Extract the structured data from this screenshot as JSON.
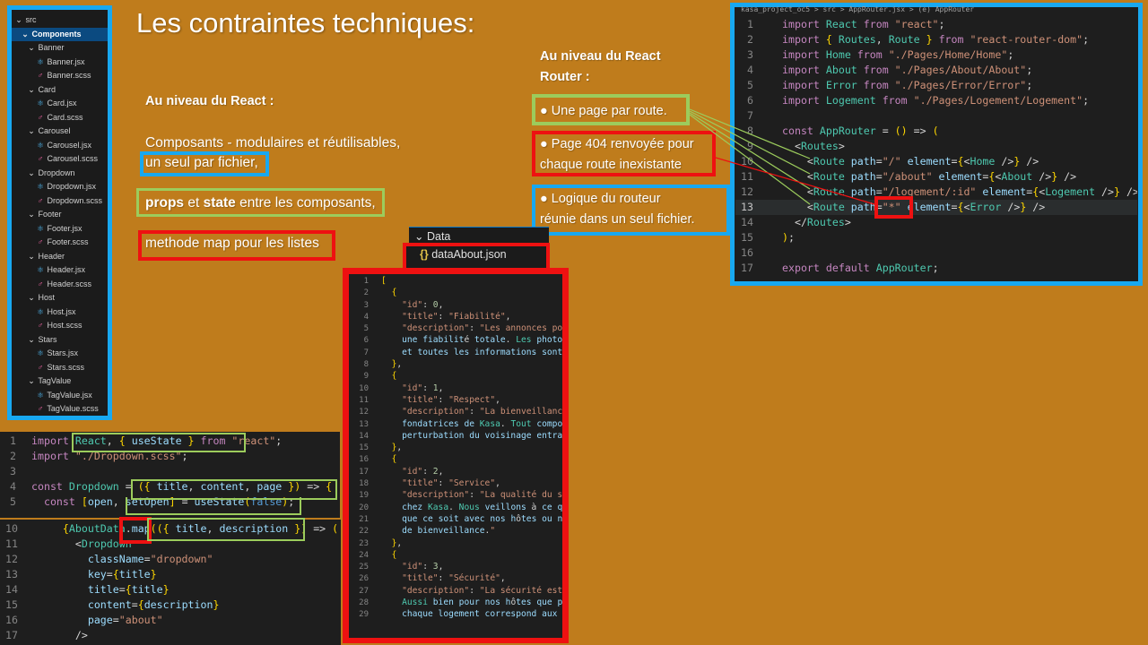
{
  "slide": {
    "title": "Les contraintes techniques:",
    "react_heading": "Au niveau du React :",
    "react_line1": "Composants - modulaires et réutilisables,",
    "react_line2": "un seul par fichier,",
    "props_bold": "props",
    "props_and": " et ",
    "state_bold": "state",
    "props_rest": " entre les composants,",
    "map_text": " methode map pour les listes",
    "router_heading_1": "Au niveau du React",
    "router_heading_2": "Router :",
    "bullet1": "● Une page par route.",
    "bullet2_1": "● Page 404 renvoyée pour",
    "bullet2_2": "chaque route inexistante",
    "bullet3_1": "● Logique du routeur",
    "bullet3_2": "réunie dans un seul fichier."
  },
  "file_tree": {
    "root": "src",
    "selected": "Components",
    "groups": [
      {
        "folder": "Banner",
        "files": [
          "Banner.jsx",
          "Banner.scss"
        ]
      },
      {
        "folder": "Card",
        "files": [
          "Card.jsx",
          "Card.scss"
        ]
      },
      {
        "folder": "Carousel",
        "files": [
          "Carousel.jsx",
          "Carousel.scss"
        ]
      },
      {
        "folder": "Dropdown",
        "files": [
          "Dropdown.jsx",
          "Dropdown.scss"
        ]
      },
      {
        "folder": "Footer",
        "files": [
          "Footer.jsx",
          "Footer.scss"
        ]
      },
      {
        "folder": "Header",
        "files": [
          "Header.jsx",
          "Header.scss"
        ]
      },
      {
        "folder": "Host",
        "files": [
          "Host.jsx",
          "Host.scss"
        ]
      },
      {
        "folder": "Stars",
        "files": [
          "Stars.jsx",
          "Stars.scss"
        ]
      },
      {
        "folder": "TagValue",
        "files": [
          "TagValue.jsx",
          "TagValue.scss"
        ]
      }
    ]
  },
  "data_explorer": {
    "folder": "Data",
    "file": "dataAbout.json"
  },
  "router_editor": {
    "breadcrumb": "kasa_project_oc5 > src > AppRouter.jsx > (e) AppRouter",
    "active_line": 13,
    "lines": [
      {
        "n": 1,
        "t": "import React from \"react\";"
      },
      {
        "n": 2,
        "t": "import { Routes, Route } from \"react-router-dom\";"
      },
      {
        "n": 3,
        "t": "import Home from \"./Pages/Home/Home\";"
      },
      {
        "n": 4,
        "t": "import About from \"./Pages/About/About\";"
      },
      {
        "n": 5,
        "t": "import Error from \"./Pages/Error/Error\";"
      },
      {
        "n": 6,
        "t": "import Logement from \"./Pages/Logement/Logement\";"
      },
      {
        "n": 7,
        "t": ""
      },
      {
        "n": 8,
        "t": "const AppRouter = () => ("
      },
      {
        "n": 9,
        "t": "  <Routes>"
      },
      {
        "n": 10,
        "t": "    <Route path=\"/\" element={<Home />} />"
      },
      {
        "n": 11,
        "t": "    <Route path=\"/about\" element={<About />} />"
      },
      {
        "n": 12,
        "t": "    <Route path=\"/logement/:id\" element={<Logement />} />"
      },
      {
        "n": 13,
        "t": "    <Route path=\"*\" element={<Error />} />"
      },
      {
        "n": 14,
        "t": "  </Routes>"
      },
      {
        "n": 15,
        "t": ");"
      },
      {
        "n": 16,
        "t": ""
      },
      {
        "n": 17,
        "t": "export default AppRouter;"
      }
    ]
  },
  "json_editor": {
    "lines": [
      {
        "n": 1,
        "t": "["
      },
      {
        "n": 2,
        "t": "  {"
      },
      {
        "n": 3,
        "t": "    \"id\": 0,"
      },
      {
        "n": 4,
        "t": "    \"title\": \"Fiabilité\","
      },
      {
        "n": 5,
        "t": "    \"description\": \"Les annonces po"
      },
      {
        "n": 6,
        "t": "    une fiabilité totale. Les photo"
      },
      {
        "n": 7,
        "t": "    et toutes les informations sont"
      },
      {
        "n": 8,
        "t": "  },"
      },
      {
        "n": 9,
        "t": "  {"
      },
      {
        "n": 10,
        "t": "    \"id\": 1,"
      },
      {
        "n": 11,
        "t": "    \"title\": \"Respect\","
      },
      {
        "n": 12,
        "t": "    \"description\": \"La bienveillanc"
      },
      {
        "n": 13,
        "t": "    fondatrices de Kasa. Tout compo"
      },
      {
        "n": 14,
        "t": "    perturbation du voisinage entra"
      },
      {
        "n": 15,
        "t": "  },"
      },
      {
        "n": 16,
        "t": "  {"
      },
      {
        "n": 17,
        "t": "    \"id\": 2,"
      },
      {
        "n": 18,
        "t": "    \"title\": \"Service\","
      },
      {
        "n": 19,
        "t": "    \"description\": \"La qualité du s"
      },
      {
        "n": 20,
        "t": "    chez Kasa. Nous veillons à ce q"
      },
      {
        "n": 21,
        "t": "    que ce soit avec nos hôtes ou n"
      },
      {
        "n": 22,
        "t": "    de bienveillance.\""
      },
      {
        "n": 23,
        "t": "  },"
      },
      {
        "n": 24,
        "t": "  {"
      },
      {
        "n": 25,
        "t": "    \"id\": 3,"
      },
      {
        "n": 26,
        "t": "    \"title\": \"Sécurité\","
      },
      {
        "n": 27,
        "t": "    \"description\": \"La sécurité est"
      },
      {
        "n": 28,
        "t": "    Aussi bien pour nos hôtes que p"
      },
      {
        "n": 29,
        "t": "    chaque logement correspond aux"
      }
    ]
  },
  "dropdown_editor": {
    "lines": [
      {
        "n": 1,
        "t": "import React, { useState } from \"react\";"
      },
      {
        "n": 2,
        "t": "import \"./Dropdown.scss\";"
      },
      {
        "n": 3,
        "t": ""
      },
      {
        "n": 4,
        "t": "const Dropdown = ({ title, content, page }) => {"
      },
      {
        "n": 5,
        "t": "  const [open, setOpen] = useState(false);"
      }
    ]
  },
  "map_editor": {
    "lines": [
      {
        "n": 10,
        "t": "    {AboutData.map(({ title, description }) => ("
      },
      {
        "n": 11,
        "t": "      <Dropdown"
      },
      {
        "n": 12,
        "t": "        className=\"dropdown\""
      },
      {
        "n": 13,
        "t": "        key={title}"
      },
      {
        "n": 14,
        "t": "        title={title}"
      },
      {
        "n": 15,
        "t": "        content={description}"
      },
      {
        "n": 16,
        "t": "        page=\"about\""
      },
      {
        "n": 17,
        "t": "      />"
      }
    ]
  },
  "colors": {
    "background": "#bf7c1c",
    "blue": "#18a8f0",
    "red": "#ee1111",
    "green": "#9ccc5c"
  }
}
